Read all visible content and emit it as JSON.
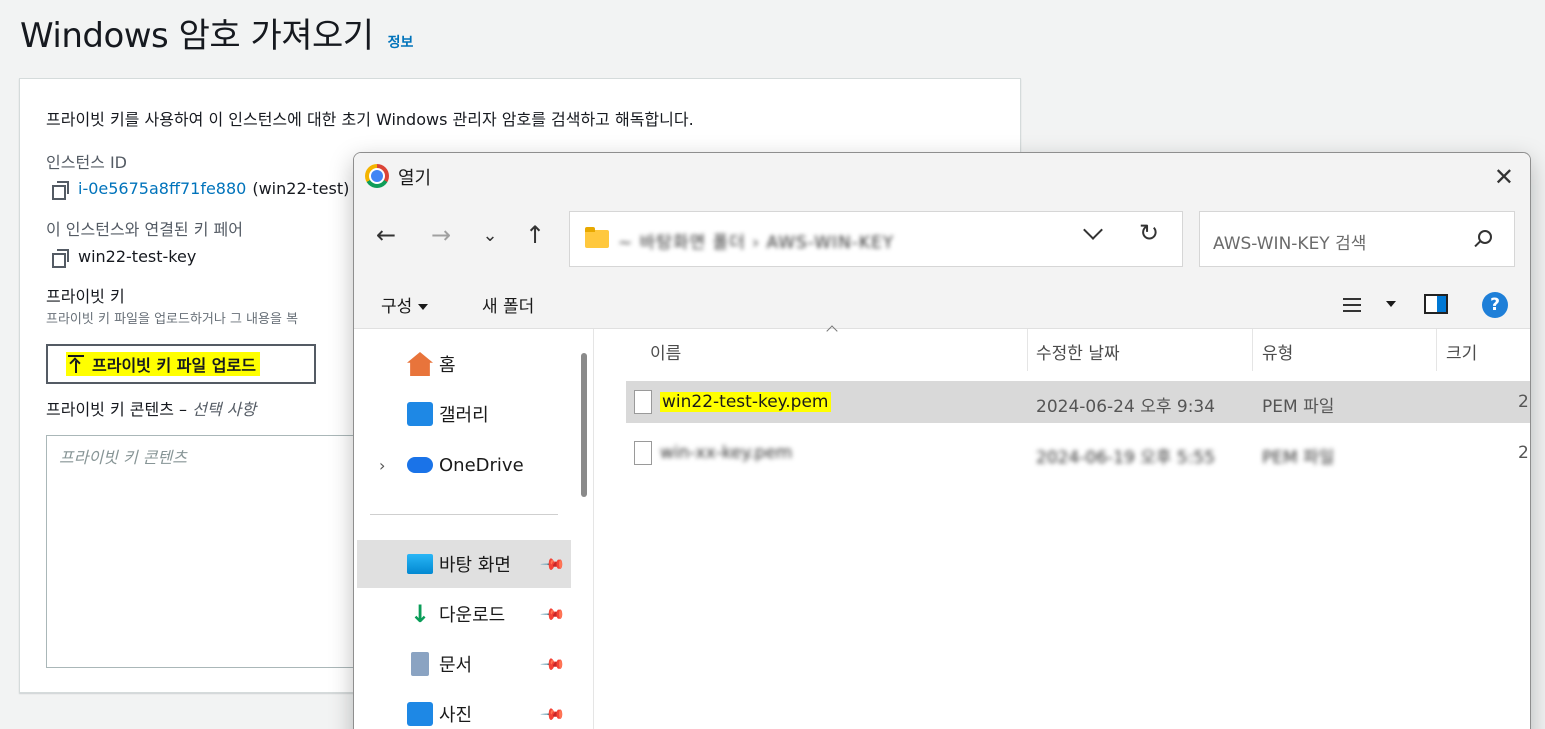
{
  "page": {
    "title": "Windows 암호 가져오기",
    "info_link": "정보"
  },
  "panel": {
    "description": "프라이빗 키를 사용하여 이 인스턴스에 대한 초기 Windows 관리자 암호를 검색하고 해독합니다.",
    "instance_id_label": "인스턴스 ID",
    "instance_id": "i-0e5675a8ff71fe880",
    "instance_name": "(win22-test)",
    "keypair_label": "이 인스턴스와 연결된 키 페어",
    "keypair": "win22-test-key",
    "private_key_label": "프라이빗 키",
    "private_key_hint": "프라이빗 키 파일을 업로드하거나 그 내용을 복",
    "upload_button": "프라이빗 키 파일 업로드",
    "content_label": "프라이빗 키 콘텐츠 – ",
    "content_optional": "선택 사항",
    "content_placeholder": "프라이빗 키 콘텐츠"
  },
  "dialog": {
    "title": "열기",
    "close": "✕",
    "address_path": "~ 바탕화면 폴더 › AWS-WIN-KEY",
    "search_placeholder": "AWS-WIN-KEY 검색",
    "organize": "구성",
    "new_folder": "새 폴더",
    "help": "?",
    "sidebar": [
      {
        "label": "홈",
        "icon": "home-icon"
      },
      {
        "label": "갤러리",
        "icon": "gallery-icon"
      },
      {
        "label": "OneDrive",
        "icon": "onedrive-icon"
      },
      {
        "label": "바탕 화면",
        "icon": "desktop-icon"
      },
      {
        "label": "다운로드",
        "icon": "download-icon"
      },
      {
        "label": "문서",
        "icon": "documents-icon"
      },
      {
        "label": "사진",
        "icon": "pictures-icon"
      }
    ],
    "columns": {
      "name": "이름",
      "modified": "수정한 날짜",
      "type": "유형",
      "size": "크기"
    },
    "files": [
      {
        "name": "win22-test-key.pem",
        "modified": "2024-06-24 오후 9:34",
        "type": "PEM 파일",
        "size": "2"
      },
      {
        "name": "win-xx-key.pem",
        "modified": "2024-06-19 오후 5:55",
        "type": "PEM 파일",
        "size": "2"
      }
    ]
  },
  "colors": {
    "aws_link": "#0073bb",
    "highlight": "#ffff00",
    "windows_accent": "#0078d4"
  }
}
